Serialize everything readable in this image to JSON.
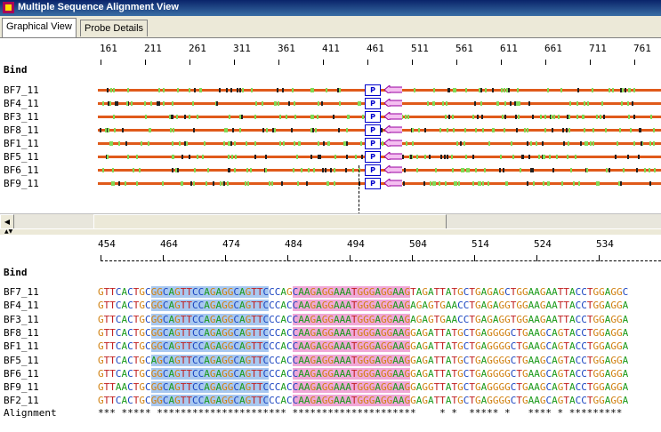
{
  "window": {
    "title": "Multiple Sequence Alignment View"
  },
  "tabs": [
    {
      "label": "Graphical View",
      "active": true
    },
    {
      "label": "Probe Details",
      "active": false
    }
  ],
  "top": {
    "ruler": [
      "161",
      "211",
      "261",
      "311",
      "361",
      "411",
      "461",
      "511",
      "561",
      "611",
      "661",
      "711",
      "761"
    ],
    "header": "Bind",
    "sequences": [
      "BF7_11",
      "BF4_11",
      "BF3_11",
      "BF8_11",
      "BF1_11",
      "BF5_11",
      "BF6_11",
      "BF9_11"
    ],
    "probe_label": "P"
  },
  "bottom": {
    "ruler": [
      "454",
      "464",
      "474",
      "484",
      "494",
      "504",
      "514",
      "524",
      "534"
    ],
    "header": "Bind",
    "rows": [
      {
        "name": "BF7_11",
        "seq": "GTTCACTGCGGCAGTTCCAGAGGCAGTTCCCAGCAAGAGGAAATGGGAGGAAGTAGATTATGCTGAGAGCTGGAAGAATTACCTGGAGGC"
      },
      {
        "name": "BF4_11",
        "seq": "GTTCACTGCGGCAGTTCCAGAGGCAGTTCCCACCAAGAGGAAATGGGAGGAAGAGAGTGAACCTGAGAGGTGGAAGAATTACCTGGAGGA"
      },
      {
        "name": "BF3_11",
        "seq": "GTTCACTGCGGCAGTTCCAGAGGCAGTTCCCACCAAGAGGAAATGGGAGGAAGAGAGTGAACCTGAGAGGTGGAAGAATTACCTGGAGGA"
      },
      {
        "name": "BF8_11",
        "seq": "GTTCACTGCGGCAGTTCCAGAGGCAGTTCCCACCAAGAGGAAATGGGAGGAAGGAGATTATGCTGAGGGGCTGAAGCAGTACCTGGAGGA"
      },
      {
        "name": "BF1_11",
        "seq": "GTTCACTGCGGCAGTTCCAGAGGCAGTTCCCACCAAGAGGAAATGGGAGGAAGGAGATTATGCTGAGGGGCTGAAGCAGTACCTGGAGGA"
      },
      {
        "name": "BF5_11",
        "seq": "GTTCACTGCAGCAGTTCCAGAGGCAGTTCCCACCAAGAGGAAATGGGAGGAAGGAGATTATGCTGAGGGGCTGAAGCAGTACCTGGAGGA"
      },
      {
        "name": "BF6_11",
        "seq": "GTTCACTGCGGCAGTTCCAGAGGCAGTTCCCACCAAGAGGAAATGGGAGGAAGGAGATTATGCTGAGGGGCTGAAGCAGTACCTGGAGGA"
      },
      {
        "name": "BF9_11",
        "seq": "GTTAACTGCGGCAGTTCCAGAGGCAGTTCCCACCAAGAGGAAATGGGAGGAAGGAGGTTATGCTGAGGGGCTGAAGCAGTACCTGGAGGA"
      },
      {
        "name": "BF2_11",
        "seq": "GTTCACTGCGGCAGTTCCAGAGGCAGTTCCCACCAAGAGGAAATGGGAGGAAGGAGATTATGCTGAGGGGCTGAAGCAGTACCTGGAGGA"
      }
    ],
    "alignment_label": "Alignment",
    "alignment": "*** ***** ********************** *********************    * *  ***** *   **** * *********"
  },
  "colors": {
    "A": "#1a9a1a",
    "C": "#1a44c0",
    "G": "#d08010",
    "T": "#c02020",
    "line": "#e05a1a",
    "probe": "#0000cc",
    "highlight_blue": "#a8c8f0",
    "highlight_pink": "#f0a8d8"
  }
}
